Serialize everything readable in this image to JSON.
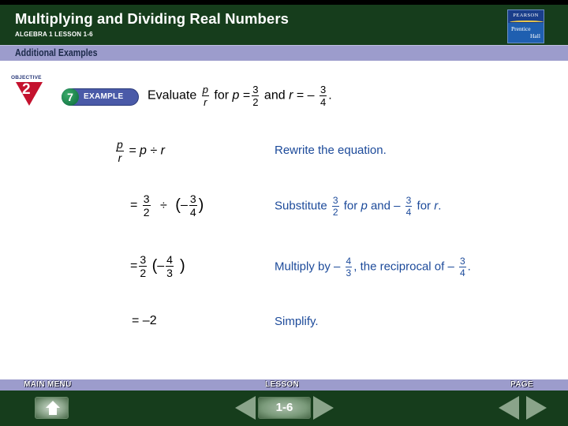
{
  "header": {
    "title": "Multiplying and Dividing Real Numbers",
    "subtitle": "ALGEBRA 1  LESSON 1-6",
    "logo": {
      "top": "PEARSON",
      "line1": "Prentice",
      "line2": "Hall"
    }
  },
  "section": {
    "label": "Additional Examples"
  },
  "objective": {
    "label": "OBJECTIVE",
    "number": "2"
  },
  "example": {
    "number": "7",
    "label": "EXAMPLE"
  },
  "problem": {
    "evaluate": "Evaluate",
    "expr_num": "p",
    "expr_den": "r",
    "for_p": "for",
    "p_var": "p",
    "eq1": "=",
    "p_num": "3",
    "p_den": "2",
    "and": "and",
    "r_var": "r",
    "eq2": "= –",
    "r_num": "3",
    "r_den": "4",
    "period": "."
  },
  "steps": [
    {
      "lhs_num": "p",
      "lhs_den": "r",
      "expr": "= p ÷ r",
      "explanation": "Rewrite the equation."
    },
    {
      "eq": "=",
      "a_num": "3",
      "a_den": "2",
      "op": "÷",
      "open": "(",
      "neg": "–",
      "b_num": "3",
      "b_den": "4",
      "close": ")",
      "explanation": {
        "prefix": "Substitute",
        "f1_num": "3",
        "f1_den": "2",
        "mid1": "for",
        "var1": "p",
        "mid2": "and –",
        "f2_num": "3",
        "f2_den": "4",
        "mid3": "for",
        "var2": "r",
        "suffix": "."
      }
    },
    {
      "eq": "=",
      "a_num": "3",
      "a_den": "2",
      "open": "(",
      "neg": "–",
      "b_num": "4",
      "b_den": "3",
      "close": ")",
      "explanation": {
        "prefix": "Multiply by –",
        "f1_num": "4",
        "f1_den": "3",
        "mid": ", the reciprocal of –",
        "f2_num": "3",
        "f2_den": "4",
        "suffix": "."
      }
    },
    {
      "expr": "= –2",
      "explanation": "Simplify."
    }
  ],
  "footer": {
    "main_menu": "MAIN MENU",
    "lesson": "LESSON",
    "lesson_number": "1-6",
    "page": "PAGE",
    "icons": {
      "home": "home-icon",
      "lesson_prev": "arrow-left-icon",
      "lesson_next": "arrow-right-icon",
      "page_prev": "arrow-left-icon",
      "page_next": "arrow-right-icon"
    }
  },
  "colors": {
    "header_bg": "#163d1c",
    "bar_bg": "#9c9ccc",
    "explanation_text": "#1c4a9a",
    "objective_red": "#c4122e",
    "example_pill": "#4a5aa8"
  }
}
